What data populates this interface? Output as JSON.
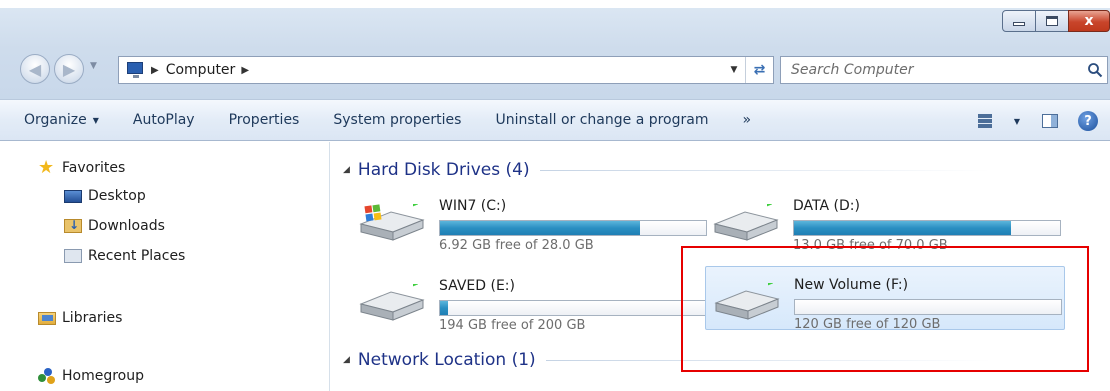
{
  "window": {
    "caption_buttons": [
      "minimize",
      "maximize",
      "close"
    ],
    "close_glyph": "x"
  },
  "address_bar": {
    "crumbs": [
      "Computer"
    ]
  },
  "search": {
    "placeholder": "Search Computer"
  },
  "command_bar": {
    "items": [
      {
        "label": "Organize",
        "has_dropdown": true
      },
      {
        "label": "AutoPlay",
        "has_dropdown": false
      },
      {
        "label": "Properties",
        "has_dropdown": false
      },
      {
        "label": "System properties",
        "has_dropdown": false
      },
      {
        "label": "Uninstall or change a program",
        "has_dropdown": false
      }
    ],
    "overflow_label": "»",
    "help_label": "?"
  },
  "nav_pane": {
    "favorites_label": "Favorites",
    "favorites": [
      "Desktop",
      "Downloads",
      "Recent Places"
    ],
    "libraries_label": "Libraries",
    "homegroup_label": "Homegroup"
  },
  "content": {
    "groups": [
      {
        "title": "Hard Disk Drives (4)"
      },
      {
        "title": "Network Location (1)"
      }
    ],
    "drives": [
      {
        "name": "WIN7 (C:)",
        "free_text": "6.92 GB free of 28.0 GB",
        "used_fraction": 0.753,
        "has_windows_logo": true,
        "selected": false
      },
      {
        "name": "DATA (D:)",
        "free_text": "13.0 GB free of 70.0 GB",
        "used_fraction": 0.814,
        "has_windows_logo": false,
        "selected": false
      },
      {
        "name": "SAVED (E:)",
        "free_text": "194 GB free of 200 GB",
        "used_fraction": 0.03,
        "has_windows_logo": false,
        "selected": false
      },
      {
        "name": "New Volume (F:)",
        "free_text": "120 GB free of 120 GB",
        "used_fraction": 0.0,
        "has_windows_logo": false,
        "selected": true
      }
    ]
  },
  "colors": {
    "group_title": "#1e3287",
    "bar_fill": "#2a8fc2",
    "highlight": "#e60000",
    "selection_bg": "#d6e8fb"
  }
}
